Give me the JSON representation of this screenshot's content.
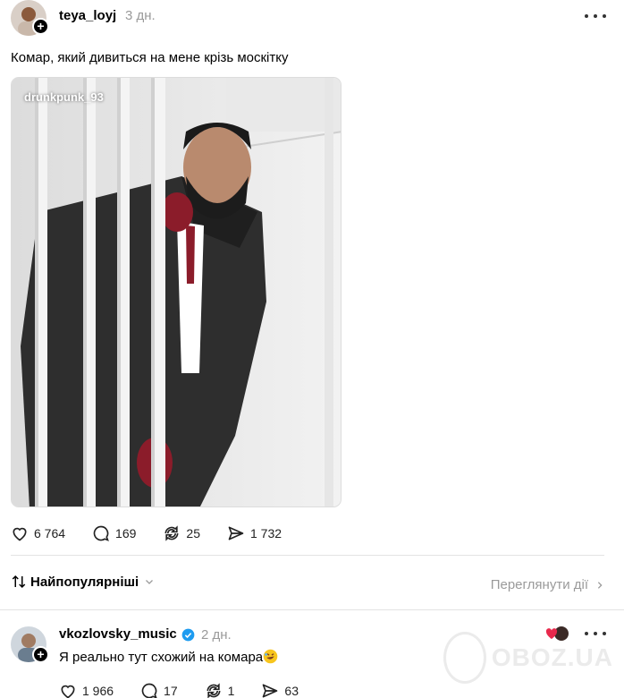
{
  "post": {
    "username": "teya_loyj",
    "time": "3 дн.",
    "text": "Комар, який дивиться на мене крізь москітку",
    "media_tag": "drunkpunk_93",
    "likes": "6 764",
    "comments": "169",
    "reposts": "25",
    "shares": "1 732"
  },
  "sort": {
    "label": "Найпопулярніші",
    "view_activity": "Переглянути дії"
  },
  "reply": {
    "username": "vkozlovsky_music",
    "time": "2 дн.",
    "text": "Я реально тут схожий на комара",
    "likes": "1 966",
    "comments": "17",
    "reposts": "1",
    "shares": "63"
  },
  "watermark": {
    "site": "OBOZ.UA"
  },
  "colors": {
    "text": "#000000",
    "muted": "#9a9a9a",
    "verified": "#1d9bf0",
    "like_heart": "#e8294c"
  }
}
